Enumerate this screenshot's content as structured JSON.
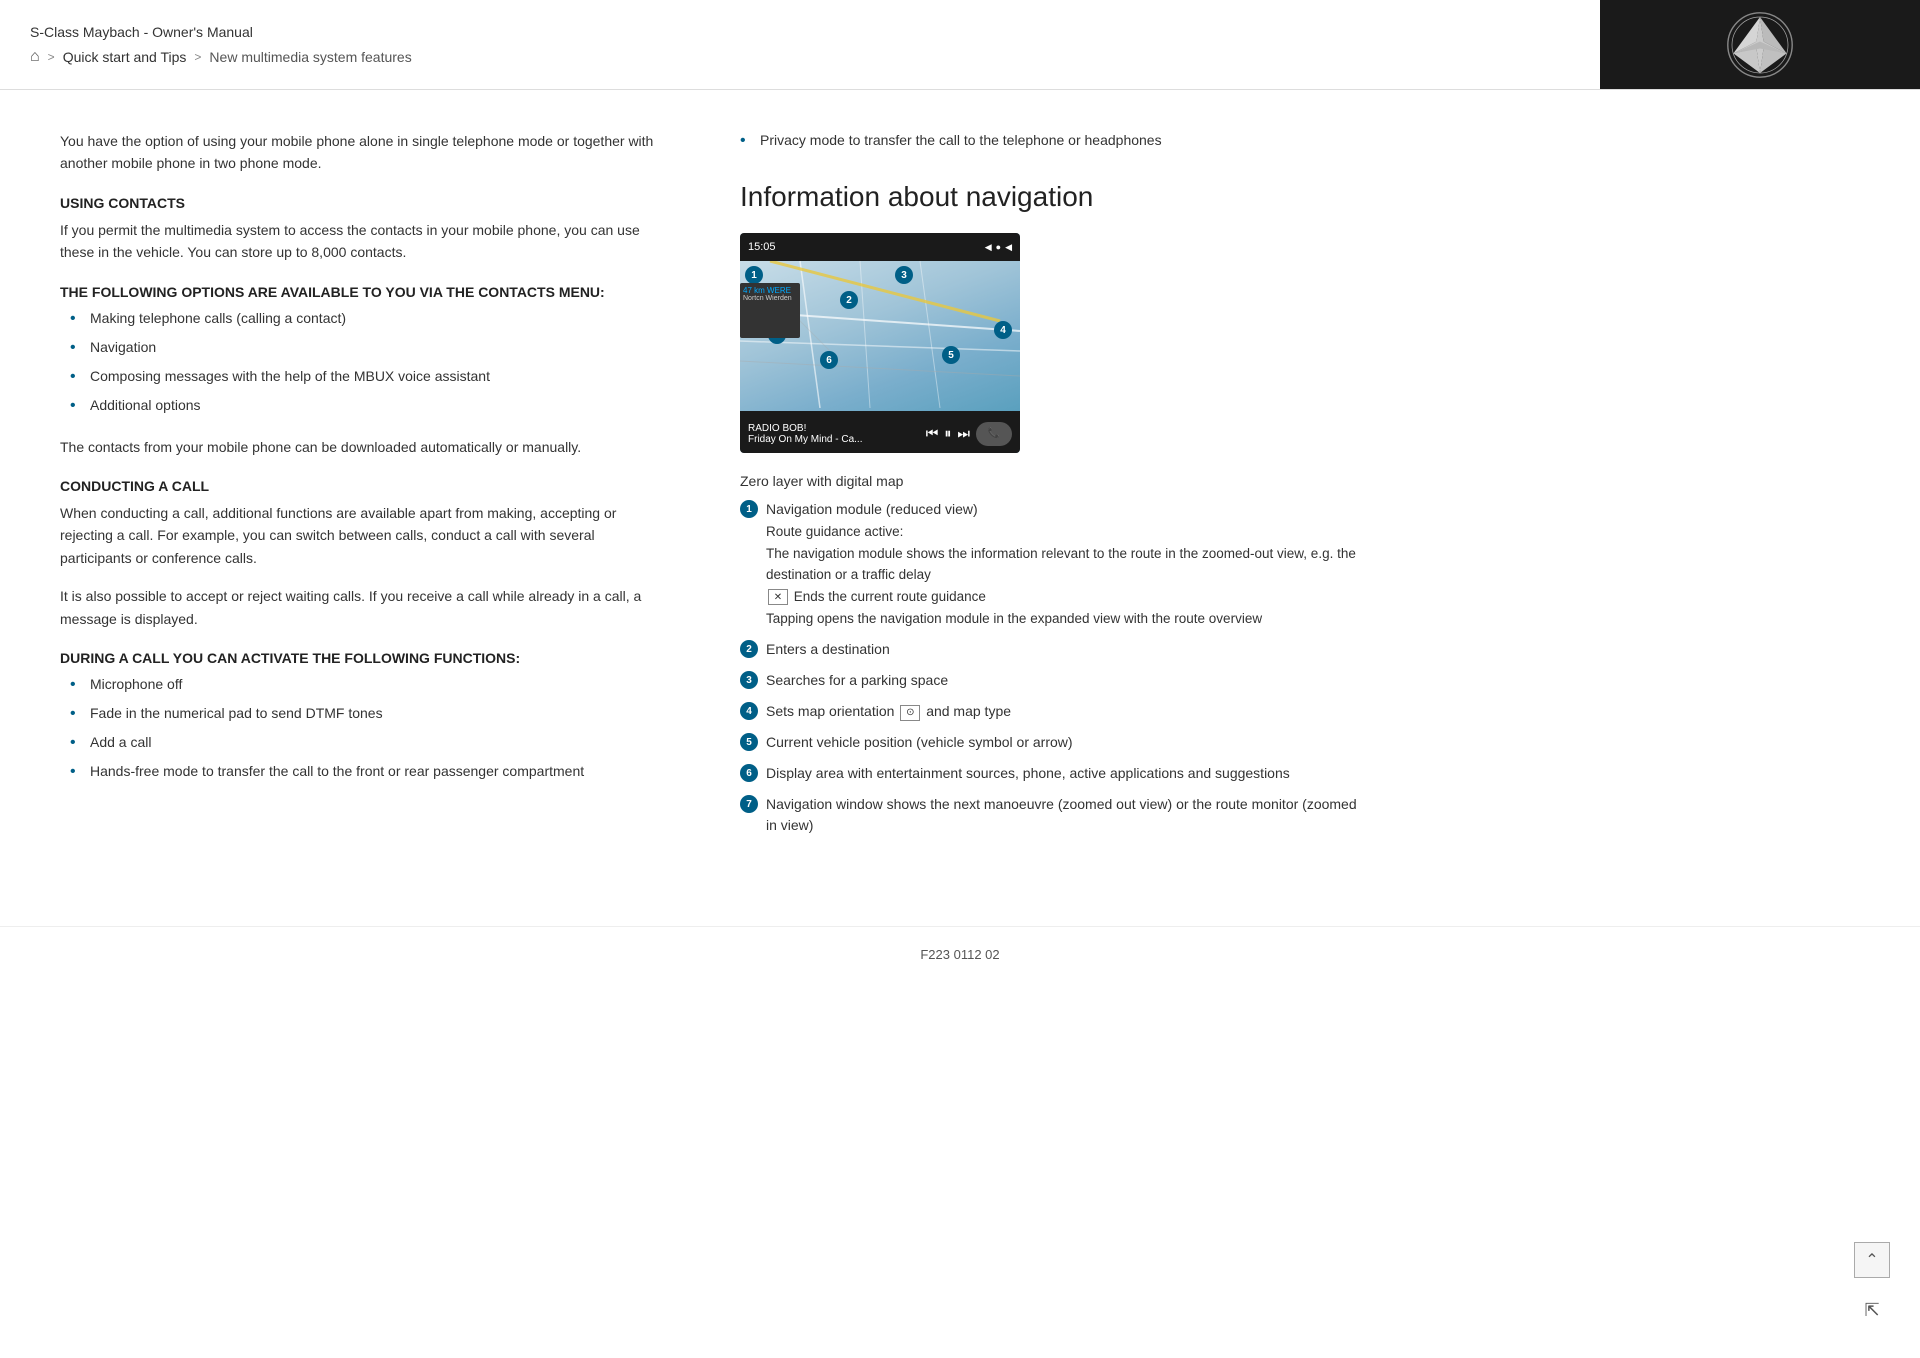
{
  "header": {
    "title": "S-Class Maybach - Owner's Manual",
    "breadcrumb": {
      "home_label": "🏠",
      "separator1": ">",
      "link1_label": "Quick start and Tips",
      "separator2": ">",
      "link2_label": "New multimedia system features"
    }
  },
  "left_column": {
    "intro_text": "You have the option of using your mobile phone alone in single telephone mode or together with another mobile phone in two phone mode.",
    "section1": {
      "heading": "USING CONTACTS",
      "text": "If you permit the multimedia system to access the contacts in your mobile phone, you can use these in the vehicle. You can store up to 8,000 contacts."
    },
    "section2": {
      "heading": "THE FOLLOWING OPTIONS ARE AVAILABLE TO YOU VIA THE CONTACTS MENU:",
      "bullets": [
        "Making telephone calls (calling a contact)",
        "Navigation",
        "Composing messages with the help of the MBUX voice assistant",
        "Additional options"
      ]
    },
    "contacts_download_text": "The contacts from your mobile phone can be downloaded automatically or manually.",
    "section3": {
      "heading": "CONDUCTING A CALL",
      "text1": "When conducting a call, additional functions are available apart from making, accepting or rejecting a call. For example, you can switch between calls, conduct a call with several participants or conference calls.",
      "text2": "It is also possible to accept or reject waiting calls. If you receive a call while already in a call, a message is displayed."
    },
    "section4": {
      "heading": "DURING A CALL YOU CAN ACTIVATE THE FOLLOWING FUNCTIONS:",
      "bullets": [
        "Microphone off",
        "Fade in the numerical pad to send DTMF tones",
        "Add a call",
        "Hands-free mode to transfer the call to the front or rear passenger compartment"
      ]
    }
  },
  "right_column": {
    "privacy_bullet": "Privacy mode to transfer the call to the telephone or headphones",
    "nav_heading": "Information about navigation",
    "zero_layer_text": "Zero layer with digital map",
    "nav_items": [
      {
        "number": "1",
        "label": "Navigation module (reduced view)",
        "sub_lines": [
          "Route guidance active:",
          "The navigation module shows the information relevant to the route in the zoomed-out view, e.g. the destination or a traffic delay",
          "Ends the current route guidance",
          "Tapping opens the navigation module in the expanded view with the route overview"
        ]
      },
      {
        "number": "2",
        "label": "Enters a destination",
        "sub_lines": []
      },
      {
        "number": "3",
        "label": "Searches for a parking space",
        "sub_lines": []
      },
      {
        "number": "4",
        "label": "Sets map orientation",
        "sub_lines": [],
        "has_icon": true,
        "after_icon": "and map type"
      },
      {
        "number": "5",
        "label": "Current vehicle position (vehicle symbol or arrow)",
        "sub_lines": []
      },
      {
        "number": "6",
        "label": "Display area with entertainment sources, phone, active applications and suggestions",
        "sub_lines": []
      },
      {
        "number": "7",
        "label": "Navigation window shows the next manoeuvre (zoomed out view) or the route monitor (zoomed in view)",
        "sub_lines": []
      }
    ]
  },
  "footer": {
    "doc_code": "F223 0112 02"
  },
  "map": {
    "time": "15:05",
    "radio_label": "RADIO BOB!",
    "radio_sub": "Friday On My Mind - Ca..."
  }
}
